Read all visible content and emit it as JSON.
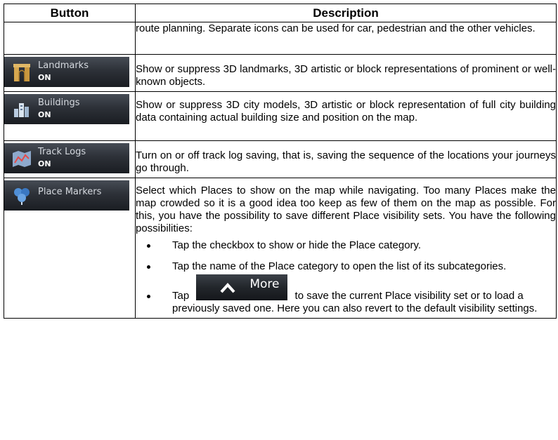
{
  "table": {
    "headers": {
      "button": "Button",
      "description": "Description"
    },
    "rows": [
      {
        "description": "route planning. Separate icons can be used for car, pedestrian and the other vehicles."
      },
      {
        "button": {
          "label": "Landmarks",
          "state": "ON",
          "icon": "landmark-arch-icon"
        },
        "description": "Show or suppress 3D landmarks, 3D artistic or block representations of prominent or well-known objects."
      },
      {
        "button": {
          "label": "Buildings",
          "state": "ON",
          "icon": "buildings-icon"
        },
        "description": "Show or suppress 3D city models, 3D artistic or block representation of full city building data containing actual building size and position on the map."
      },
      {
        "button": {
          "label": "Track Logs",
          "state": "ON",
          "icon": "track-log-map-icon"
        },
        "description": "Turn on or off track log saving, that is, saving the sequence of the locations your journeys go through."
      },
      {
        "button": {
          "label": "Place Markers",
          "icon": "place-markers-icon"
        },
        "description": "Select which Places to show on the map while navigating. Too many Places make the map crowded so it is a good idea too keep as few of them on the map as possible. For this, you have the possibility to save different Place visibility sets. You have the following possibilities:",
        "bullets": [
          "Tap the checkbox to show or hide the Place category.",
          "Tap the name of the Place category to open the list of its subcategories."
        ],
        "tap_item": {
          "prefix": "Tap",
          "button_label": "More",
          "suffix_line1": "to save the current Place visibility set",
          "suffix_rest": "or to load a previously saved one. Here you can also revert to the default visibility settings."
        }
      }
    ]
  }
}
